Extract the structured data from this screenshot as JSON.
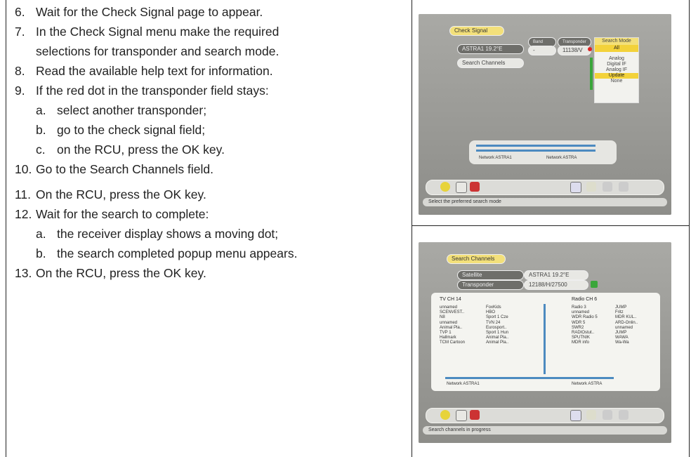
{
  "steps": [
    {
      "num": "6.",
      "text": "Wait for the Check Signal page to appear."
    },
    {
      "num": "7.",
      "text": "In the Check Signal menu make the required"
    },
    {
      "num": "",
      "text": "selections for transponder and search mode."
    },
    {
      "num": "8.",
      "text": "Read the available help text for information."
    },
    {
      "num": "9.",
      "text": "If the red dot in the transponder field stays:"
    },
    {
      "num": "a.",
      "text": "select another transponder;"
    },
    {
      "num": "b.",
      "text": "go to the check signal field;"
    },
    {
      "num": "c.",
      "text": "on the RCU, press the OK key."
    },
    {
      "num": "10.",
      "text": "Go to the Search Channels field."
    },
    {
      "num": "11.",
      "text": "On the RCU, press the OK key."
    },
    {
      "num": "12.",
      "text": "Wait for the search to complete:"
    },
    {
      "num": "a.",
      "text": "the receiver display shows a moving dot;"
    },
    {
      "num": "b.",
      "text": "the search completed popup menu appears."
    },
    {
      "num": "13.",
      "text": "On the RCU, press the OK key."
    }
  ],
  "screen1": {
    "title": "Check Signal",
    "satellite": "ASTRA1 19.2°E",
    "search_channels": "Search Channels",
    "band_header": "Band",
    "band_value": "-",
    "transponder_header": "Transponder",
    "transponder_value": "11138/V",
    "search_mode_header": "Search Mode",
    "search_mode_value": "All",
    "menu": [
      "Analog",
      "Digital IF",
      "Analog IF",
      "Update",
      "None"
    ],
    "bar_label_left": "Network ASTRA1",
    "bar_label_right": "Network ASTRA",
    "status": "Select the preferred search mode"
  },
  "screen2": {
    "title": "Search Channels",
    "satellite_label": "Satellite",
    "satellite_value": "ASTRA1 19.2°E",
    "transponder_label": "Transponder",
    "transponder_value": "12188/H/27500",
    "tv_header": "TV CH 14",
    "radio_header": "Radio CH 6",
    "tv_col1": [
      "unnamed",
      "SCENVEST..",
      "N8",
      "unnamed",
      "Animal Pla..",
      "TVP 1",
      "Hallmark",
      "TCM Cartoon"
    ],
    "tv_col2": [
      "FoxKids",
      "HBO",
      "Sport 1 Cze",
      "TVN 24",
      "Eurosport..",
      "Sport 1 Hun",
      "Animal Pla..",
      "Animal Pla.."
    ],
    "radio_col1": [
      "Radio 3",
      "unnamed",
      "WDR Radio 5",
      "WDR 5",
      "SWR2",
      "RADIOstut..",
      "SPUTNIK",
      "MDR info"
    ],
    "radio_col2": [
      "JUMP",
      "Fritz",
      "MDR KUL..",
      "ARD-Onlin..",
      "unnamed",
      "JUMP",
      "WAWA",
      "Wa-Wa"
    ],
    "bar_label_left": "Network ASTRA1",
    "bar_label_right": "Network ASTRA",
    "status": "Search channels in progress"
  }
}
